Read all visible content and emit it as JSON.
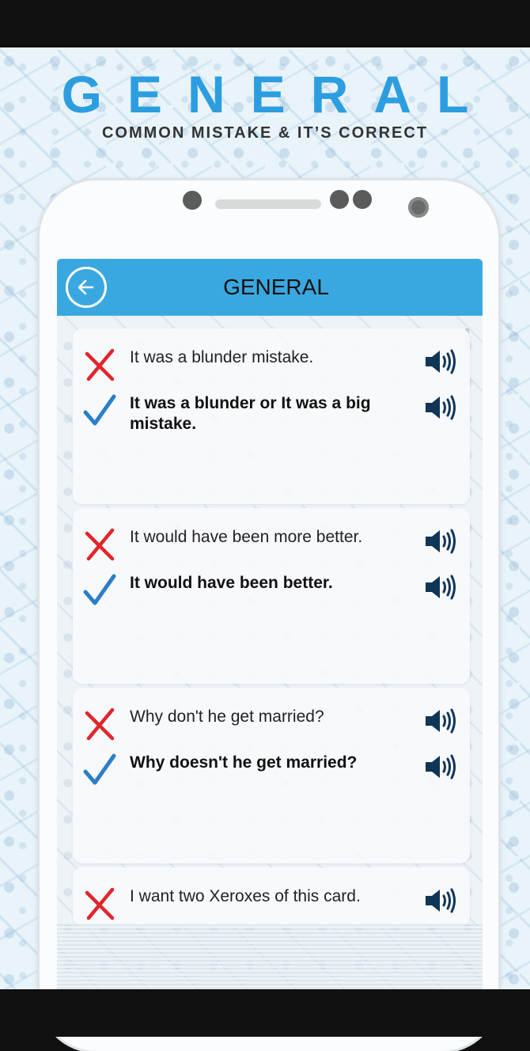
{
  "banner": {
    "headline": "GENERAL",
    "subline": "COMMON MISTAKE & IT’S CORRECT"
  },
  "app": {
    "title": "GENERAL"
  },
  "entries": [
    {
      "wrong": "It was a blunder mistake.",
      "correct": "It was a blunder or It was a big mistake."
    },
    {
      "wrong": "It would have been more better.",
      "correct": "It would have been better."
    },
    {
      "wrong": "Why don't he get married?",
      "correct": "Why doesn't he get married?"
    },
    {
      "wrong": "I want two Xeroxes of this card."
    }
  ],
  "icons": {
    "back": "back-arrow-icon",
    "wrong": "cross-icon",
    "correct": "check-icon",
    "speak": "speaker-icon"
  },
  "colors": {
    "accent": "#3aa8e0",
    "headline": "#2c9ee0",
    "wrong": "#e0262b",
    "correct": "#2a7fc8",
    "speaker": "#0f3557"
  }
}
